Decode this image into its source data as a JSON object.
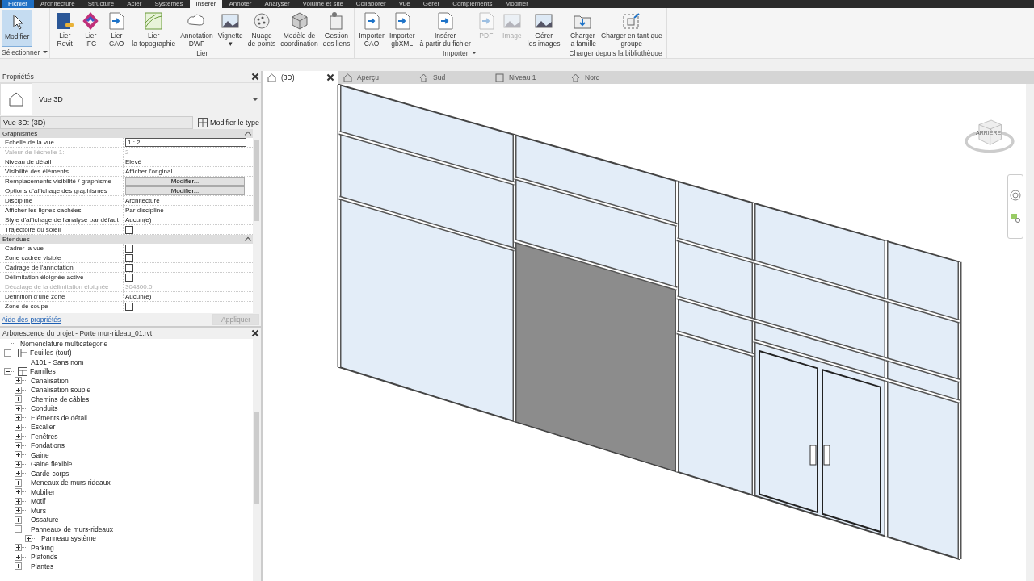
{
  "ribbon_tabs": [
    {
      "label": "Fichier",
      "selected": false,
      "kind": "file"
    },
    {
      "label": "Architecture",
      "selected": false,
      "kind": "tab"
    },
    {
      "label": "Structure",
      "selected": false,
      "kind": "tab"
    },
    {
      "label": "Acier",
      "selected": false,
      "kind": "tab"
    },
    {
      "label": "Systèmes",
      "selected": false,
      "kind": "tab"
    },
    {
      "label": "Insérer",
      "selected": true,
      "kind": "tab"
    },
    {
      "label": "Annoter",
      "selected": false,
      "kind": "tab"
    },
    {
      "label": "Analyser",
      "selected": false,
      "kind": "tab"
    },
    {
      "label": "Volume et site",
      "selected": false,
      "kind": "tab"
    },
    {
      "label": "Collaborer",
      "selected": false,
      "kind": "tab"
    },
    {
      "label": "Vue",
      "selected": false,
      "kind": "tab"
    },
    {
      "label": "Gérer",
      "selected": false,
      "kind": "tab"
    },
    {
      "label": "Compléments",
      "selected": false,
      "kind": "tab"
    },
    {
      "label": "Modifier",
      "selected": false,
      "kind": "tab"
    }
  ],
  "ribbon_groups": [
    {
      "title": "Sélectionner",
      "dropdown": true,
      "buttons": [
        {
          "lines": [
            "Modifier"
          ],
          "selected": true,
          "disabled": false
        }
      ]
    },
    {
      "title": "Lier",
      "dropdown": false,
      "buttons": [
        {
          "lines": [
            "Lier",
            "Revit"
          ],
          "selected": false,
          "disabled": false
        },
        {
          "lines": [
            "Lier",
            "IFC"
          ],
          "selected": false,
          "disabled": false
        },
        {
          "lines": [
            "Lier",
            "CAO"
          ],
          "selected": false,
          "disabled": false
        },
        {
          "lines": [
            "Lier",
            "la topographie"
          ],
          "selected": false,
          "disabled": false
        },
        {
          "lines": [
            "Annotation",
            "DWF"
          ],
          "selected": false,
          "disabled": false
        },
        {
          "lines": [
            "Vignette",
            "▾"
          ],
          "selected": false,
          "disabled": false
        },
        {
          "lines": [
            "Nuage",
            "de points"
          ],
          "selected": false,
          "disabled": false
        },
        {
          "lines": [
            "Modèle de",
            "coordination"
          ],
          "selected": false,
          "disabled": false
        },
        {
          "lines": [
            "Gestion",
            "des liens"
          ],
          "selected": false,
          "disabled": false
        }
      ]
    },
    {
      "title": "Importer",
      "dropdown": true,
      "buttons": [
        {
          "lines": [
            "Importer",
            "CAO"
          ],
          "selected": false,
          "disabled": false
        },
        {
          "lines": [
            "Importer",
            "gbXML"
          ],
          "selected": false,
          "disabled": false
        },
        {
          "lines": [
            "Insérer",
            "à partir du fichier"
          ],
          "selected": false,
          "disabled": false
        },
        {
          "lines": [
            "PDF"
          ],
          "selected": false,
          "disabled": true
        },
        {
          "lines": [
            "Image"
          ],
          "selected": false,
          "disabled": true
        },
        {
          "lines": [
            "Gérer",
            "les images"
          ],
          "selected": false,
          "disabled": false
        }
      ]
    },
    {
      "title": "Charger depuis la bibliothèque",
      "dropdown": false,
      "buttons": [
        {
          "lines": [
            "Charger",
            "la famille"
          ],
          "selected": false,
          "disabled": false
        },
        {
          "lines": [
            "Charger en tant que",
            "groupe"
          ],
          "selected": false,
          "disabled": false
        }
      ]
    }
  ],
  "properties": {
    "title": "Propriétés",
    "type_name": "Vue 3D",
    "selector": "Vue 3D: (3D)",
    "edit_type": "Modifier le type",
    "sections": [
      {
        "title": "Graphismes",
        "rows": [
          {
            "label": "Echelle de la vue",
            "value": "1 : 2",
            "kind": "input",
            "disabled": false
          },
          {
            "label": "Valeur de l'échelle    1:",
            "value": "2",
            "kind": "text",
            "disabled": true
          },
          {
            "label": "Niveau de détail",
            "value": "Elevé",
            "kind": "text",
            "disabled": false
          },
          {
            "label": "Visibilité des éléments",
            "value": "Afficher l'original",
            "kind": "text",
            "disabled": false
          },
          {
            "label": "Remplacements visibilité / graphisme",
            "value": "Modifier...",
            "kind": "button",
            "disabled": false
          },
          {
            "label": "Options d'affichage des graphismes",
            "value": "Modifier...",
            "kind": "button",
            "disabled": false
          },
          {
            "label": "Discipline",
            "value": "Architecture",
            "kind": "text",
            "disabled": false
          },
          {
            "label": "Afficher les lignes cachées",
            "value": "Par discipline",
            "kind": "text",
            "disabled": false
          },
          {
            "label": "Style d'affichage de l'analyse par défaut",
            "value": "Aucun(e)",
            "kind": "text",
            "disabled": false
          },
          {
            "label": "Trajectoire du soleil",
            "checked": false,
            "kind": "checkbox",
            "disabled": false
          }
        ]
      },
      {
        "title": "Etendues",
        "rows": [
          {
            "label": "Cadrer la vue",
            "checked": false,
            "kind": "checkbox",
            "disabled": false
          },
          {
            "label": "Zone cadrée visible",
            "checked": false,
            "kind": "checkbox",
            "disabled": false
          },
          {
            "label": "Cadrage de l'annotation",
            "checked": false,
            "kind": "checkbox",
            "disabled": false
          },
          {
            "label": "Délimitation éloignée active",
            "checked": false,
            "kind": "checkbox",
            "disabled": false
          },
          {
            "label": "Décalage de la délimitation éloignée",
            "value": "304800.0",
            "kind": "text",
            "disabled": true
          },
          {
            "label": "Définition d'une zone",
            "value": "Aucun(e)",
            "kind": "text",
            "disabled": false
          },
          {
            "label": "Zone de coupe",
            "checked": false,
            "kind": "checkbox",
            "disabled": false
          }
        ]
      }
    ],
    "help_link": "Aide des propriétés",
    "apply_button": "Appliquer"
  },
  "project_browser": {
    "title": "Arborescence du projet - Porte mur-rideau_01.rvt",
    "items": [
      {
        "label": "Nomenclature multicatégorie"
      },
      {
        "label": "Feuilles (tout)",
        "kind": "sheets",
        "expanded": true,
        "children": [
          {
            "label": "A101 - Sans nom"
          }
        ]
      },
      {
        "label": "Familles",
        "kind": "families",
        "expanded": true,
        "children": [
          {
            "label": "Canalisation",
            "expanded": false
          },
          {
            "label": "Canalisation souple",
            "expanded": false
          },
          {
            "label": "Chemins de câbles",
            "expanded": false
          },
          {
            "label": "Conduits",
            "expanded": false
          },
          {
            "label": "Eléments de détail",
            "expanded": false
          },
          {
            "label": "Escalier",
            "expanded": false
          },
          {
            "label": "Fenêtres",
            "expanded": false
          },
          {
            "label": "Fondations",
            "expanded": false
          },
          {
            "label": "Gaine",
            "expanded": false
          },
          {
            "label": "Gaine flexible",
            "expanded": false
          },
          {
            "label": "Garde-corps",
            "expanded": false
          },
          {
            "label": "Meneaux de murs-rideaux",
            "expanded": false
          },
          {
            "label": "Mobilier",
            "expanded": false
          },
          {
            "label": "Motif",
            "expanded": false
          },
          {
            "label": "Murs",
            "expanded": false
          },
          {
            "label": "Ossature",
            "expanded": false
          },
          {
            "label": "Panneaux de murs-rideaux",
            "expanded": true,
            "children": [
              {
                "label": "Panneau système",
                "expanded": false
              }
            ]
          },
          {
            "label": "Parking",
            "expanded": false
          },
          {
            "label": "Plafonds",
            "expanded": false
          },
          {
            "label": "Plantes",
            "expanded": false
          }
        ]
      }
    ]
  },
  "view_tabs": [
    {
      "label": "(3D)",
      "kind": "perspective",
      "selected": true,
      "closable": true
    },
    {
      "label": "Aperçu",
      "kind": "perspective",
      "selected": false,
      "closable": false
    },
    {
      "label": "Sud",
      "kind": "elevation",
      "selected": false,
      "closable": false
    },
    {
      "label": "Niveau 1",
      "kind": "plan",
      "selected": false,
      "closable": false
    },
    {
      "label": "Nord",
      "kind": "elevation",
      "selected": false,
      "closable": false
    }
  ],
  "viewcube": {
    "face_label": "ARRIÈRE"
  }
}
